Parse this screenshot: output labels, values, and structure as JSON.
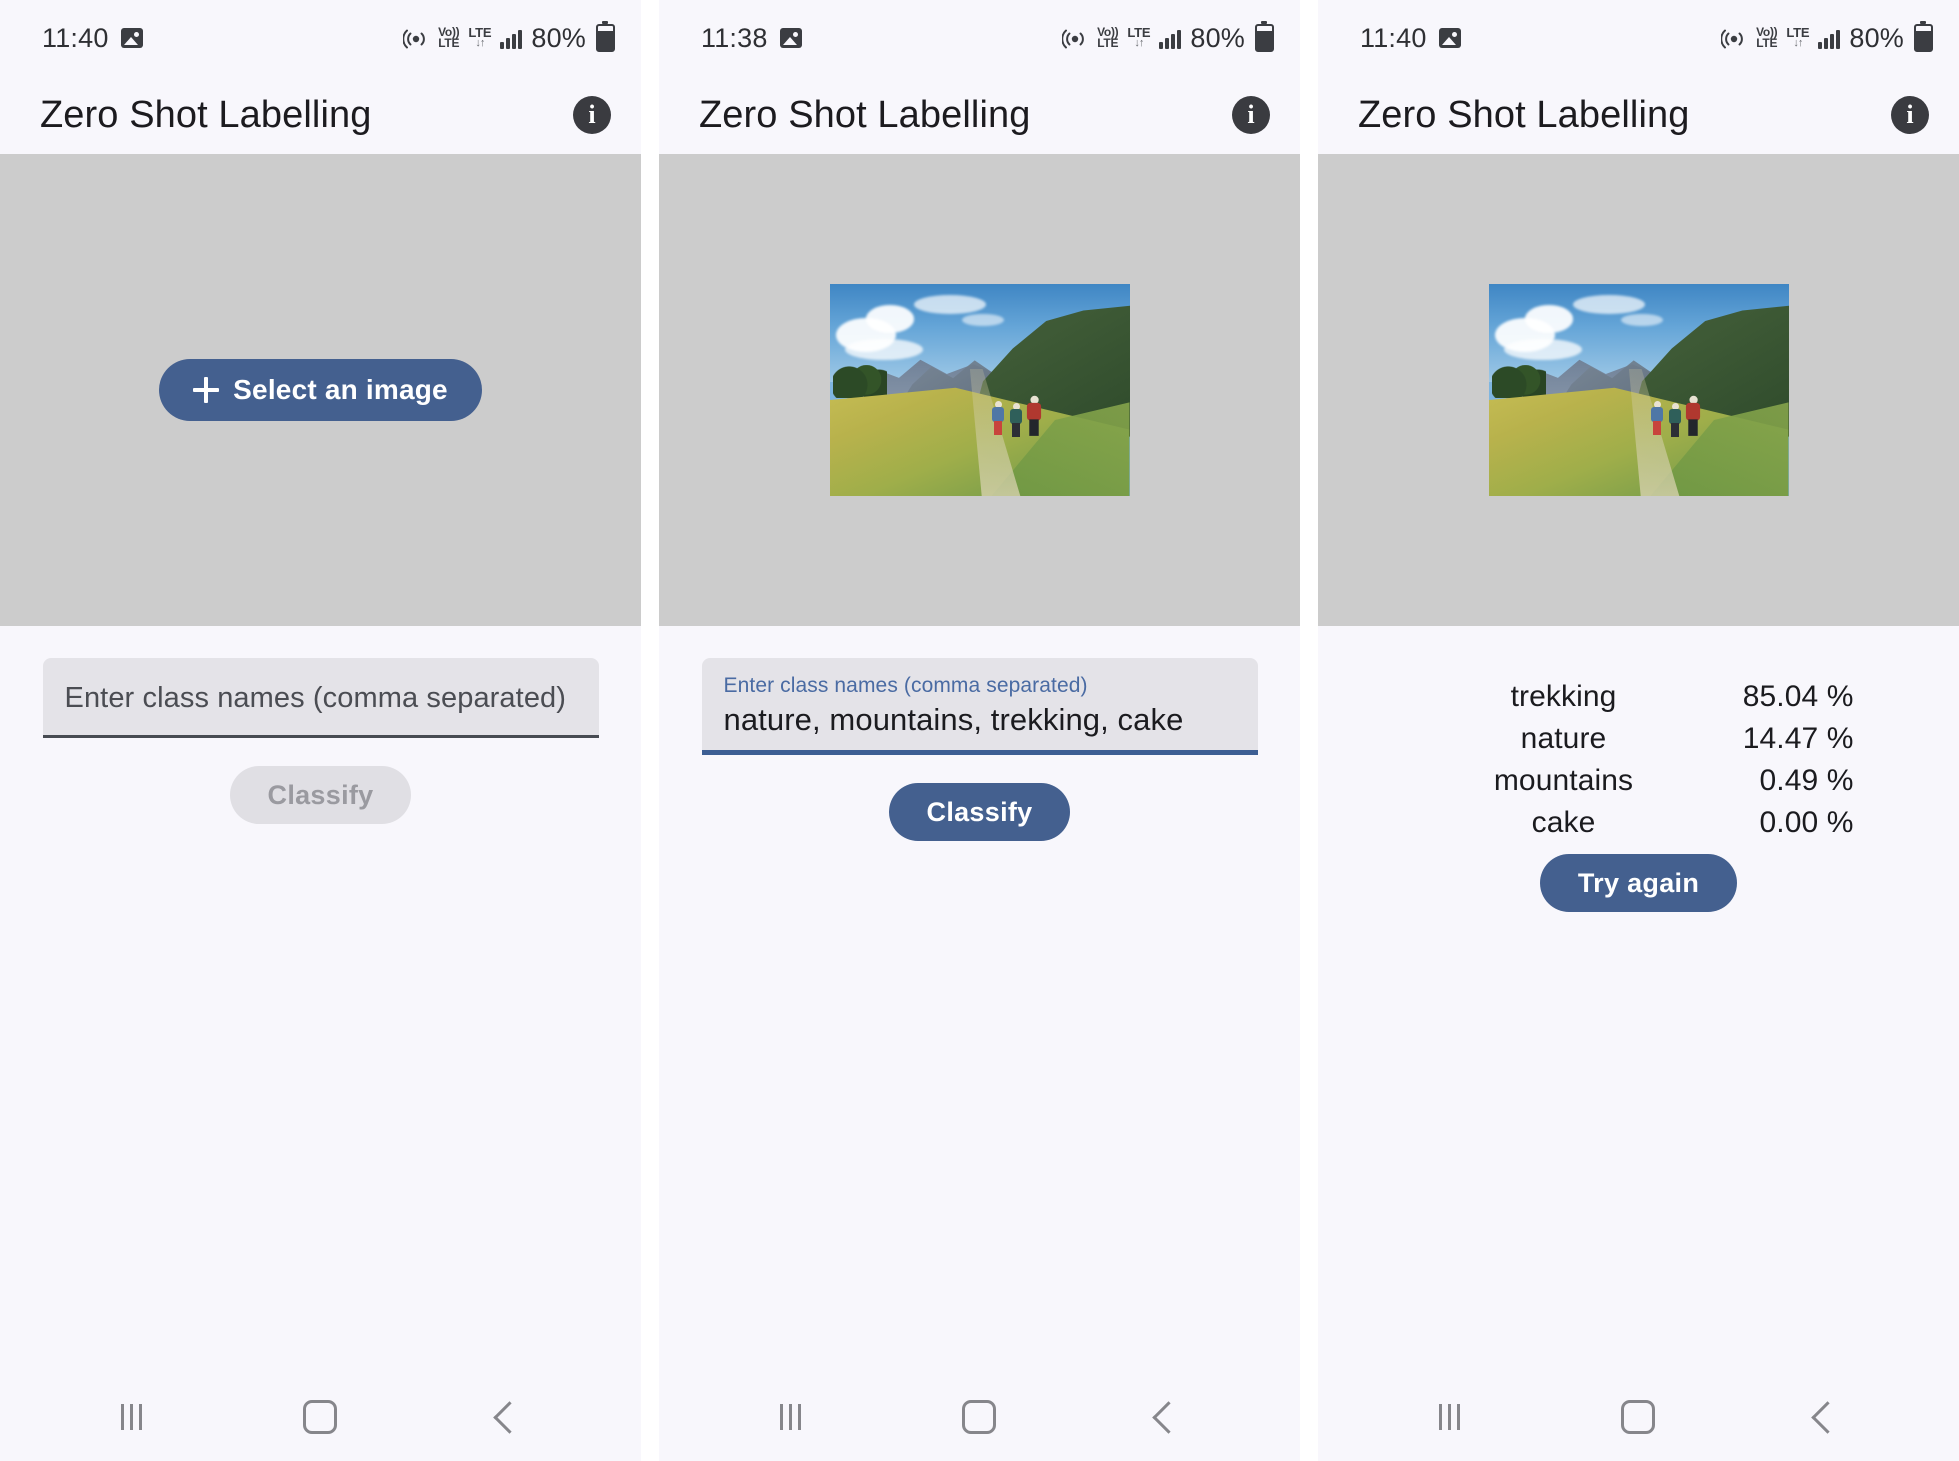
{
  "app": {
    "title": "Zero Shot Labelling",
    "info_icon": "info-icon"
  },
  "panels": [
    {
      "id": "panel-empty",
      "status": {
        "clock": "11:40",
        "gallery_icon": "gallery-icon",
        "hotspot_icon": "hotspot-icon",
        "volte_label_top": "Vo))",
        "volte_label_bottom": "LTE",
        "lte_label": "LTE",
        "lte_arrows": "↓↑",
        "signal_icon": "signal-bars-icon",
        "battery_text": "80%",
        "battery_icon": "battery-icon"
      },
      "select_button": {
        "label": "Select an image",
        "icon": "plus-icon"
      },
      "field": {
        "label": "Enter class names (comma separated)",
        "placeholder": "Enter class names (comma separated)",
        "value": "",
        "focused": false
      },
      "action_button": {
        "label": "Classify",
        "state": "disabled"
      }
    },
    {
      "id": "panel-filled",
      "status": {
        "clock": "11:38",
        "gallery_icon": "gallery-icon",
        "hotspot_icon": "hotspot-icon",
        "volte_label_top": "Vo))",
        "volte_label_bottom": "LTE",
        "lte_label": "LTE",
        "lte_arrows": "↓↑",
        "signal_icon": "signal-bars-icon",
        "battery_text": "80%",
        "battery_icon": "battery-icon"
      },
      "photo_alt": "hikers-on-mountain-trail-photo",
      "field": {
        "label": "Enter class names (comma separated)",
        "placeholder": "Enter class names (comma separated)",
        "value": "nature, mountains, trekking, cake",
        "focused": true
      },
      "action_button": {
        "label": "Classify",
        "state": "enabled"
      }
    },
    {
      "id": "panel-results",
      "status": {
        "clock": "11:40",
        "gallery_icon": "gallery-icon",
        "hotspot_icon": "hotspot-icon",
        "volte_label_top": "Vo))",
        "volte_label_bottom": "LTE",
        "lte_label": "LTE",
        "lte_arrows": "↓↑",
        "signal_icon": "signal-bars-icon",
        "battery_text": "80%",
        "battery_icon": "battery-icon"
      },
      "photo_alt": "hikers-on-mountain-trail-photo",
      "results": [
        {
          "label": "trekking",
          "value": "85.04 %"
        },
        {
          "label": "nature",
          "value": "14.47 %"
        },
        {
          "label": "mountains",
          "value": "0.49 %"
        },
        {
          "label": "cake",
          "value": "0.00 %"
        }
      ],
      "action_button": {
        "label": "Try again",
        "state": "enabled"
      }
    }
  ],
  "navbar": {
    "recents_label": "recents",
    "home_label": "home",
    "back_label": "back"
  },
  "colors": {
    "accent": "#44608f",
    "field_bg": "#e4e3e8",
    "image_bg": "#cccccc",
    "screen_bg": "#f8f7fc",
    "focus_underline": "#3d5e93",
    "disabled_bg": "#e0dfe4",
    "disabled_text": "#9a9aa0"
  }
}
